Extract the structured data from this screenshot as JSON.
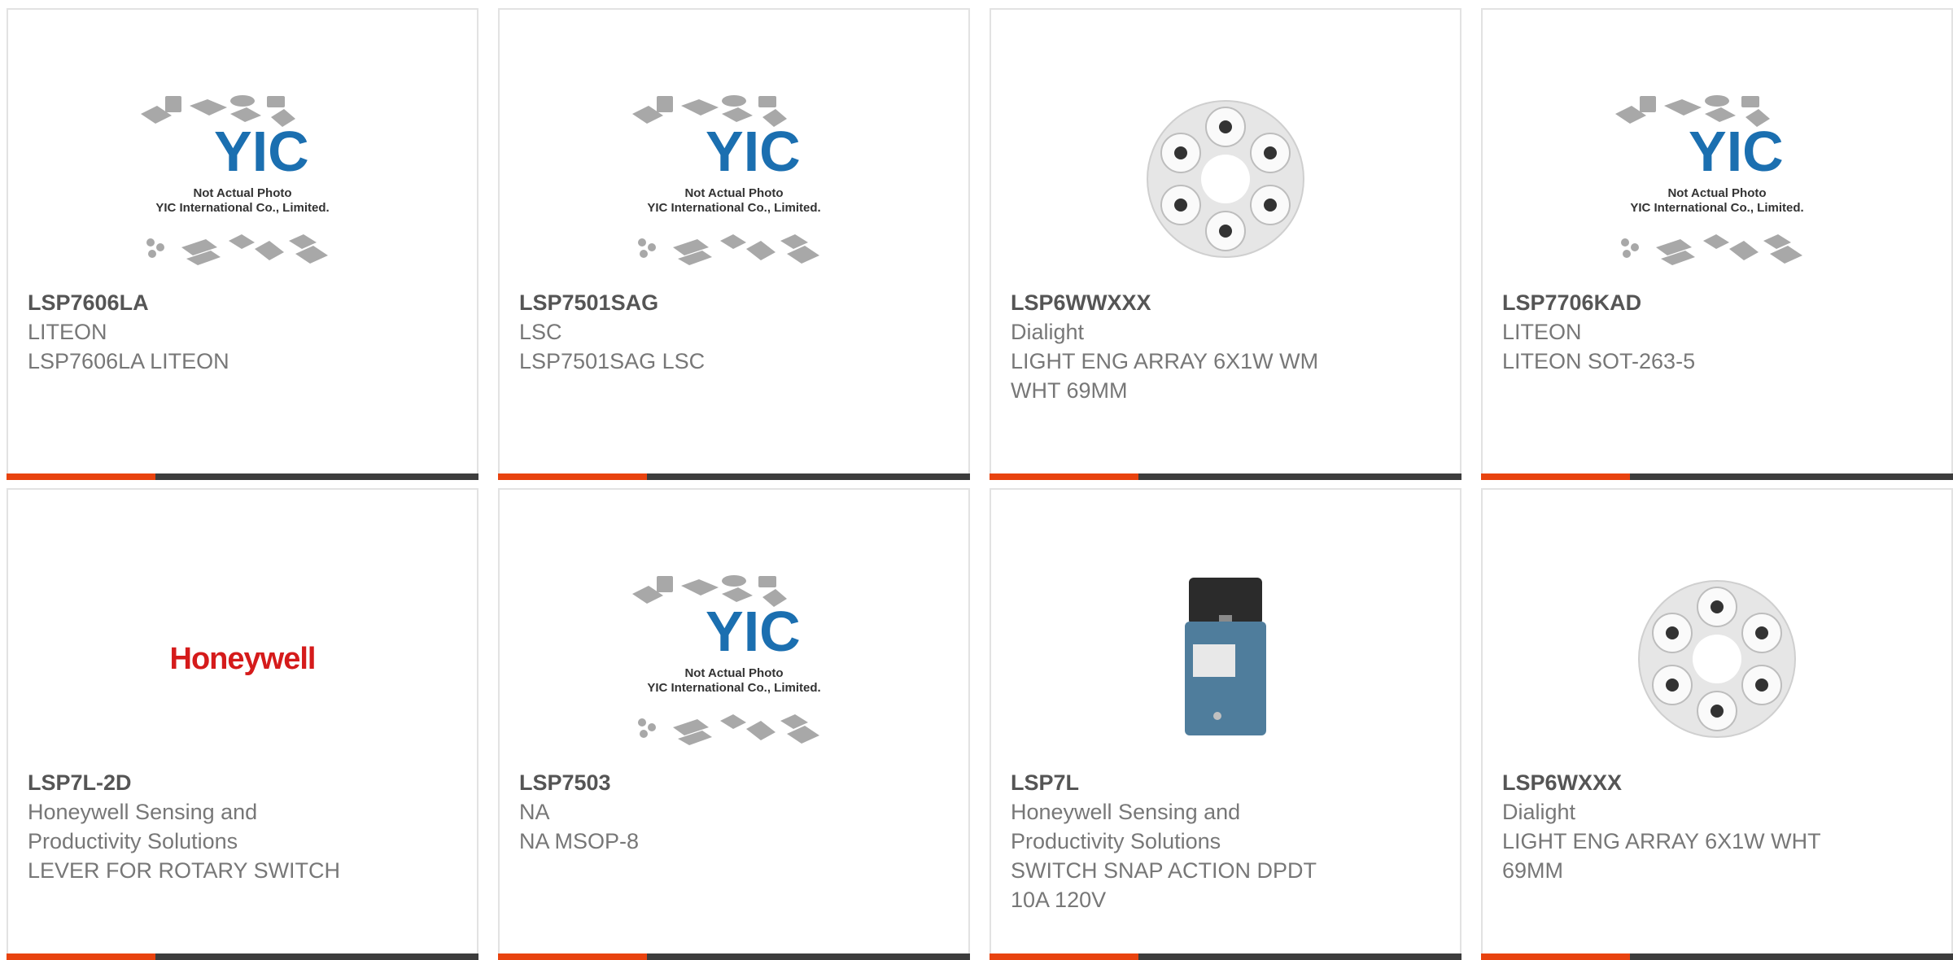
{
  "placeholder": {
    "line1": "Not Actual Photo",
    "line2": "YIC International Co., Limited.",
    "logo": "YIC"
  },
  "brand_logo_text": "Honeywell",
  "colors": {
    "accent": "#e8430f",
    "bar": "#3d3d3d",
    "border": "#e2e2e2",
    "text": "#777777",
    "brand_red": "#d51b1b"
  },
  "products": [
    {
      "part_number": "LSP7606LA",
      "manufacturer": "LITEON",
      "description": "LSP7606LA LITEON",
      "image": "placeholder-photo"
    },
    {
      "part_number": "LSP7501SAG",
      "manufacturer": "LSC",
      "description": "LSP7501SAG LSC",
      "image": "placeholder-photo"
    },
    {
      "part_number": "LSP6WWXXX",
      "manufacturer": "Dialight",
      "description": "LIGHT ENG ARRAY 6X1W WM WHT 69MM",
      "image": "led-array-photo"
    },
    {
      "part_number": "LSP7706KAD",
      "manufacturer": "LITEON",
      "description": "LITEON SOT-263-5",
      "image": "placeholder-photo"
    },
    {
      "part_number": "LSP7L-2D",
      "manufacturer": "Honeywell Sensing and Productivity Solutions",
      "description": "LEVER FOR ROTARY SWITCH",
      "image": "honeywell-logo"
    },
    {
      "part_number": "LSP7503",
      "manufacturer": "NA",
      "description": "NA MSOP-8",
      "image": "placeholder-photo"
    },
    {
      "part_number": "LSP7L",
      "manufacturer": "Honeywell Sensing and Productivity Solutions",
      "description": "SWITCH SNAP ACTION DPDT 10A 120V",
      "image": "limit-switch-photo"
    },
    {
      "part_number": "LSP6WXXX",
      "manufacturer": "Dialight",
      "description": "LIGHT ENG ARRAY 6X1W WHT 69MM",
      "image": "led-array-photo"
    }
  ]
}
